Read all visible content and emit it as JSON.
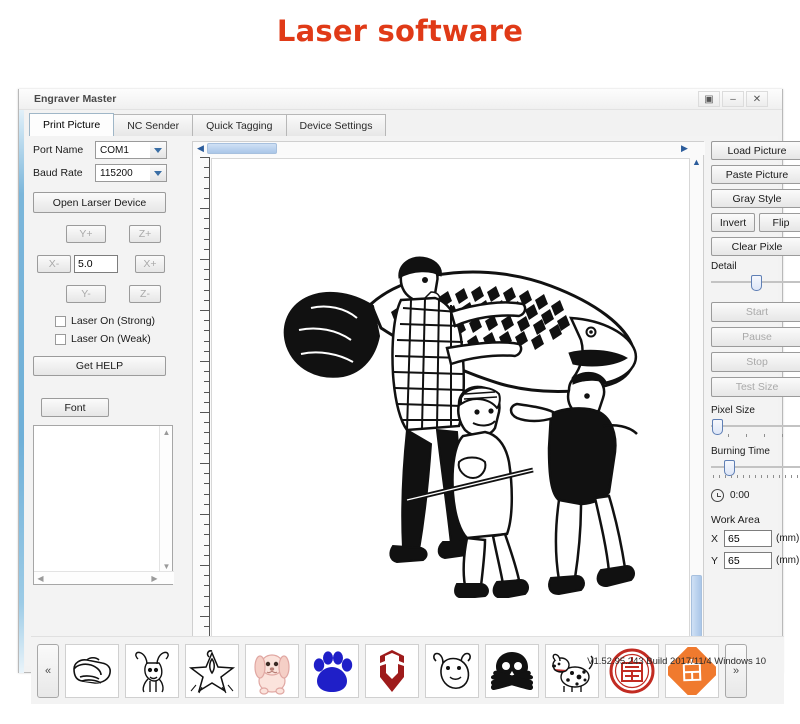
{
  "page": {
    "title": "Laser software",
    "title_color": "#e03a17"
  },
  "window": {
    "app_title": "Engraver Master",
    "controls": {
      "restore": "▣",
      "minimize": "–",
      "close": "✕"
    },
    "version_text": "V1.52.95.243 Build 2017/11/4 Windows 10"
  },
  "tabs": [
    {
      "label": "Print Picture",
      "active": true
    },
    {
      "label": "NC Sender",
      "active": false
    },
    {
      "label": "Quick Tagging",
      "active": false
    },
    {
      "label": "Device Settings",
      "active": false
    }
  ],
  "left_panel": {
    "port_name_label": "Port Name",
    "port_name_value": "COM1",
    "baud_rate_label": "Baud Rate",
    "baud_rate_value": "115200",
    "open_device_label": "Open Larser Device",
    "jog": {
      "y_plus": "Y+",
      "y_minus": "Y-",
      "x_plus": "X+",
      "x_minus": "X-",
      "z_plus": "Z+",
      "z_minus": "Z-",
      "step_value": "5.0"
    },
    "checkbox_strong": "Laser On (Strong)",
    "checkbox_weak": "Laser On (Weak)",
    "get_help_label": "Get HELP",
    "font_label": "Font",
    "text_area_value": ""
  },
  "right_panel": {
    "load_picture": "Load Picture",
    "paste_picture": "Paste Picture",
    "gray_style": "Gray Style",
    "invert": "Invert",
    "flip": "Flip",
    "clear_pixle": "Clear Pixle",
    "detail_label": "Detail",
    "detail_value": 50,
    "start": "Start",
    "pause": "Pause",
    "stop": "Stop",
    "test_size": "Test Size",
    "pixel_size_label": "Pixel Size",
    "pixel_size_value": 2,
    "burning_time_label": "Burning Time",
    "burning_time_value": 14,
    "timer_value": "0:00",
    "work_area_label": "Work Area",
    "work_area_x_axis": "X",
    "work_area_x_value": "65",
    "work_area_y_axis": "Y",
    "work_area_y_value": "65",
    "unit": "(mm)"
  },
  "thumb_strip": {
    "prev_label": "«",
    "next_label": "»",
    "items": [
      {
        "name": "pointing-hand-thumbnail"
      },
      {
        "name": "bull-thumbnail"
      },
      {
        "name": "star-thumbnail"
      },
      {
        "name": "puppy-thumbnail"
      },
      {
        "name": "paw-print-thumbnail"
      },
      {
        "name": "autobot-logo-thumbnail"
      },
      {
        "name": "cartoon-cow-thumbnail"
      },
      {
        "name": "skull-crossbones-thumbnail"
      },
      {
        "name": "dalmatian-thumbnail"
      },
      {
        "name": "fu-seal-round-thumbnail"
      },
      {
        "name": "fu-diamond-thumbnail"
      }
    ]
  },
  "canvas": {
    "artwork_name": "men-carrying-giant-fish-lineart"
  }
}
